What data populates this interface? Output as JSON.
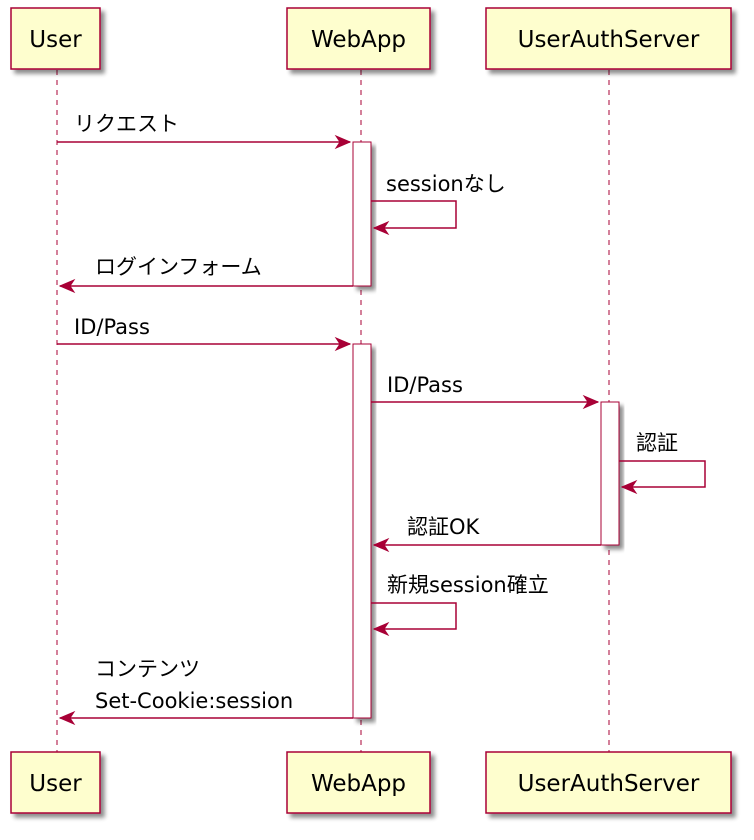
{
  "colors": {
    "participant_fill": "#FEFECE",
    "border": "#A80036",
    "shadow": "#888888"
  },
  "participants": [
    {
      "id": "user",
      "label": "User"
    },
    {
      "id": "webapp",
      "label": "WebApp"
    },
    {
      "id": "auth",
      "label": "UserAuthServer"
    }
  ],
  "messages": [
    {
      "from": "user",
      "to": "webapp",
      "label": "リクエスト"
    },
    {
      "from": "webapp",
      "to": "webapp",
      "label": "sessionなし"
    },
    {
      "from": "webapp",
      "to": "user",
      "label": "ログインフォーム"
    },
    {
      "from": "user",
      "to": "webapp",
      "label": "ID/Pass"
    },
    {
      "from": "webapp",
      "to": "auth",
      "label": "ID/Pass"
    },
    {
      "from": "auth",
      "to": "auth",
      "label": "認証"
    },
    {
      "from": "auth",
      "to": "webapp",
      "label": "認証OK"
    },
    {
      "from": "webapp",
      "to": "webapp",
      "label": "新規session確立"
    },
    {
      "from": "webapp",
      "to": "user",
      "label": "コンテンツ",
      "label_line2": "Set-Cookie:session"
    }
  ]
}
